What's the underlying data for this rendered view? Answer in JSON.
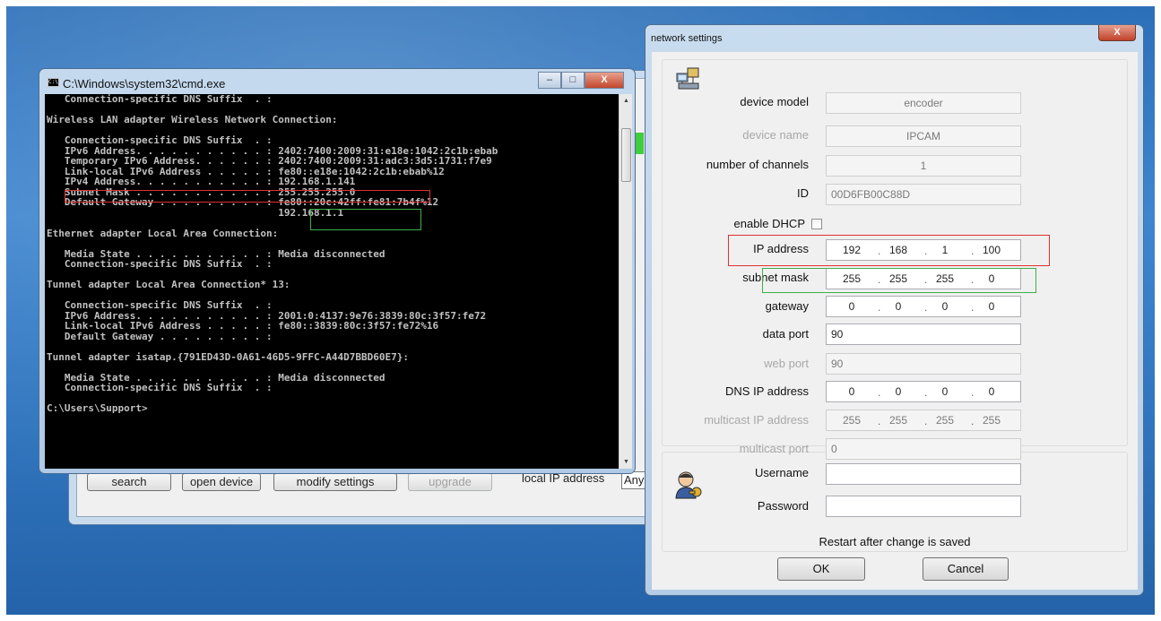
{
  "background_app": {
    "buttons": [
      {
        "label": "search",
        "disabled": false
      },
      {
        "label": "open device",
        "disabled": false
      },
      {
        "label": "modify settings",
        "disabled": false
      },
      {
        "label": "upgrade",
        "disabled": true
      }
    ],
    "local_ip_label": "local IP address",
    "local_ip_value": "Any"
  },
  "cmd": {
    "title": "C:\\Windows\\system32\\cmd.exe",
    "icon_text": "C:\\",
    "minimize": "–",
    "maximize": "□",
    "close": "X",
    "lines": [
      "   Connection-specific DNS Suffix  . :",
      "",
      "Wireless LAN adapter Wireless Network Connection:",
      "",
      "   Connection-specific DNS Suffix  . :",
      "   IPv6 Address. . . . . . . . . . . : 2402:7400:2009:31:e18e:1042:2c1b:ebab",
      "   Temporary IPv6 Address. . . . . . : 2402:7400:2009:31:adc3:3d5:1731:f7e9",
      "   Link-local IPv6 Address . . . . . : fe80::e18e:1042:2c1b:ebab%12",
      "   IPv4 Address. . . . . . . . . . . : 192.168.1.141",
      "   Subnet Mask . . . . . . . . . . . : 255.255.255.0",
      "   Default Gateway . . . . . . . . . : fe80::20c:42ff:fe81:7b4f%12",
      "                                       192.168.1.1",
      "",
      "Ethernet adapter Local Area Connection:",
      "",
      "   Media State . . . . . . . . . . . : Media disconnected",
      "   Connection-specific DNS Suffix  . :",
      "",
      "Tunnel adapter Local Area Connection* 13:",
      "",
      "   Connection-specific DNS Suffix  . :",
      "   IPv6 Address. . . . . . . . . . . : 2001:0:4137:9e76:3839:80c:3f57:fe72",
      "   Link-local IPv6 Address . . . . . : fe80::3839:80c:3f57:fe72%16",
      "   Default Gateway . . . . . . . . . :",
      "",
      "Tunnel adapter isatap.{791ED43D-0A61-46D5-9FFC-A44D7BBD60E7}:",
      "",
      "   Media State . . . . . . . . . . . : Media disconnected",
      "   Connection-specific DNS Suffix  . :",
      "",
      "C:\\Users\\Support>"
    ]
  },
  "network_settings": {
    "title": "network settings",
    "close": "X",
    "fields": {
      "device_model": {
        "label": "device model",
        "value": "encoder"
      },
      "device_name": {
        "label": "device name",
        "value": "IPCAM"
      },
      "channels": {
        "label": "number of channels",
        "value": "1"
      },
      "id": {
        "label": "ID",
        "value": "00D6FB00C88D"
      },
      "dhcp": {
        "label": "enable DHCP",
        "checked": false
      },
      "ip_address": {
        "label": "IP address",
        "octets": [
          "192",
          "168",
          "1",
          "100"
        ]
      },
      "subnet_mask": {
        "label": "subnet mask",
        "octets": [
          "255",
          "255",
          "255",
          "0"
        ]
      },
      "gateway": {
        "label": "gateway",
        "octets": [
          "0",
          "0",
          "0",
          "0"
        ]
      },
      "data_port": {
        "label": "data port",
        "value": "90"
      },
      "web_port": {
        "label": "web port",
        "value": "90"
      },
      "dns_ip": {
        "label": "DNS IP address",
        "octets": [
          "0",
          "0",
          "0",
          "0"
        ]
      },
      "multicast_ip": {
        "label": "multicast IP address",
        "octets": [
          "255",
          "255",
          "255",
          "255"
        ]
      },
      "multicast_port": {
        "label": "multicast port",
        "value": "0"
      },
      "username": {
        "label": "Username",
        "value": ""
      },
      "password": {
        "label": "Password",
        "value": ""
      }
    },
    "restart_note": "Restart after change is saved",
    "ok_label": "OK",
    "cancel_label": "Cancel"
  },
  "icons": {
    "device": "network-devices-icon",
    "user": "user-key-icon"
  },
  "colors": {
    "highlight_red": "#e03030",
    "highlight_green": "#3cb04a"
  }
}
